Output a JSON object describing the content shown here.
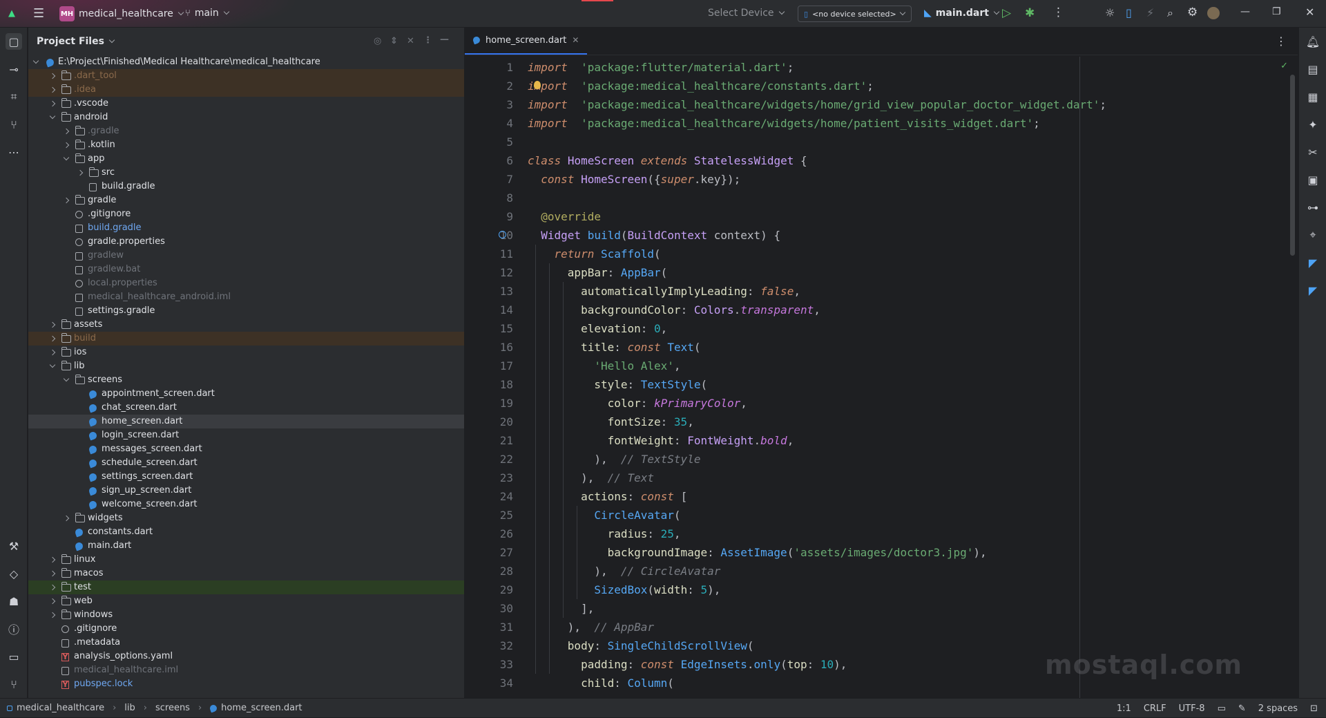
{
  "titlebar": {
    "project_badge": "MH",
    "project_name": "medical_healthcare",
    "branch": "main",
    "select_device": "Select Device",
    "device_selector": "<no device selected>",
    "run_config": "main.dart"
  },
  "panel": {
    "title": "Project Files",
    "root_path": "E:\\Project\\Finished\\Medical Healthcare\\medical_healthcare",
    "tree": [
      {
        "label": ".dart_tool",
        "depth": 1,
        "type": "folder",
        "expanded": false,
        "style": "ignored"
      },
      {
        "label": ".idea",
        "depth": 1,
        "type": "folder",
        "expanded": false,
        "style": "ignored"
      },
      {
        "label": ".vscode",
        "depth": 1,
        "type": "folder",
        "expanded": false,
        "style": ""
      },
      {
        "label": "android",
        "depth": 1,
        "type": "folder",
        "expanded": true,
        "style": ""
      },
      {
        "label": ".gradle",
        "depth": 2,
        "type": "folder",
        "expanded": false,
        "style": "dim"
      },
      {
        "label": ".kotlin",
        "depth": 2,
        "type": "folder",
        "expanded": false,
        "style": ""
      },
      {
        "label": "app",
        "depth": 2,
        "type": "folder",
        "expanded": true,
        "style": ""
      },
      {
        "label": "src",
        "depth": 3,
        "type": "folder",
        "expanded": false,
        "style": ""
      },
      {
        "label": "build.gradle",
        "depth": 3,
        "type": "file",
        "style": ""
      },
      {
        "label": "gradle",
        "depth": 2,
        "type": "folder",
        "expanded": false,
        "style": ""
      },
      {
        "label": ".gitignore",
        "depth": 2,
        "type": "gear",
        "style": ""
      },
      {
        "label": "build.gradle",
        "depth": 2,
        "type": "file",
        "style": "blue"
      },
      {
        "label": "gradle.properties",
        "depth": 2,
        "type": "gear",
        "style": ""
      },
      {
        "label": "gradlew",
        "depth": 2,
        "type": "file",
        "style": "dim"
      },
      {
        "label": "gradlew.bat",
        "depth": 2,
        "type": "file",
        "style": "dim"
      },
      {
        "label": "local.properties",
        "depth": 2,
        "type": "gear",
        "style": "dim"
      },
      {
        "label": "medical_healthcare_android.iml",
        "depth": 2,
        "type": "file",
        "style": "dim"
      },
      {
        "label": "settings.gradle",
        "depth": 2,
        "type": "file",
        "style": ""
      },
      {
        "label": "assets",
        "depth": 1,
        "type": "folder",
        "expanded": false,
        "style": ""
      },
      {
        "label": "build",
        "depth": 1,
        "type": "folder",
        "expanded": false,
        "style": "ignored-dim"
      },
      {
        "label": "ios",
        "depth": 1,
        "type": "folder",
        "expanded": false,
        "style": ""
      },
      {
        "label": "lib",
        "depth": 1,
        "type": "folder",
        "expanded": true,
        "style": ""
      },
      {
        "label": "screens",
        "depth": 2,
        "type": "folder",
        "expanded": true,
        "style": ""
      },
      {
        "label": "appointment_screen.dart",
        "depth": 3,
        "type": "dart",
        "style": ""
      },
      {
        "label": "chat_screen.dart",
        "depth": 3,
        "type": "dart",
        "style": ""
      },
      {
        "label": "home_screen.dart",
        "depth": 3,
        "type": "dart",
        "style": "selected"
      },
      {
        "label": "login_screen.dart",
        "depth": 3,
        "type": "dart",
        "style": ""
      },
      {
        "label": "messages_screen.dart",
        "depth": 3,
        "type": "dart",
        "style": ""
      },
      {
        "label": "schedule_screen.dart",
        "depth": 3,
        "type": "dart",
        "style": ""
      },
      {
        "label": "settings_screen.dart",
        "depth": 3,
        "type": "dart",
        "style": ""
      },
      {
        "label": "sign_up_screen.dart",
        "depth": 3,
        "type": "dart",
        "style": ""
      },
      {
        "label": "welcome_screen.dart",
        "depth": 3,
        "type": "dart",
        "style": ""
      },
      {
        "label": "widgets",
        "depth": 2,
        "type": "folder",
        "expanded": false,
        "style": ""
      },
      {
        "label": "constants.dart",
        "depth": 2,
        "type": "dart",
        "style": ""
      },
      {
        "label": "main.dart",
        "depth": 2,
        "type": "dart",
        "style": ""
      },
      {
        "label": "linux",
        "depth": 1,
        "type": "folder",
        "expanded": false,
        "style": ""
      },
      {
        "label": "macos",
        "depth": 1,
        "type": "folder",
        "expanded": false,
        "style": ""
      },
      {
        "label": "test",
        "depth": 1,
        "type": "folder",
        "expanded": false,
        "style": "test"
      },
      {
        "label": "web",
        "depth": 1,
        "type": "folder",
        "expanded": false,
        "style": ""
      },
      {
        "label": "windows",
        "depth": 1,
        "type": "folder",
        "expanded": false,
        "style": ""
      },
      {
        "label": ".gitignore",
        "depth": 1,
        "type": "gear",
        "style": ""
      },
      {
        "label": ".metadata",
        "depth": 1,
        "type": "lines",
        "style": ""
      },
      {
        "label": "analysis_options.yaml",
        "depth": 1,
        "type": "yaml",
        "style": ""
      },
      {
        "label": "medical_healthcare.iml",
        "depth": 1,
        "type": "file",
        "style": "dim"
      },
      {
        "label": "pubspec.lock",
        "depth": 1,
        "type": "yaml",
        "style": "blue"
      }
    ]
  },
  "editor": {
    "tab_label": "home_screen.dart",
    "lines": [
      [
        [
          "kw",
          "import"
        ],
        [
          "",
          "  "
        ],
        [
          "s",
          "'package:flutter/material.dart'"
        ],
        [
          "",
          ";"
        ]
      ],
      [
        [
          "kw",
          "import"
        ],
        [
          "",
          "  "
        ],
        [
          "s",
          "'package:medical_healthcare/constants.dart'"
        ],
        [
          "",
          ";"
        ]
      ],
      [
        [
          "kw",
          "import"
        ],
        [
          "",
          "  "
        ],
        [
          "s",
          "'package:medical_healthcare/widgets/home/grid_view_popular_doctor_widget.dart'"
        ],
        [
          "",
          ";"
        ]
      ],
      [
        [
          "kw",
          "import"
        ],
        [
          "",
          "  "
        ],
        [
          "s",
          "'package:medical_healthcare/widgets/home/patient_visits_widget.dart'"
        ],
        [
          "",
          ";"
        ]
      ],
      [],
      [
        [
          "kw",
          "class"
        ],
        [
          "",
          " "
        ],
        [
          "cls",
          "HomeScreen"
        ],
        [
          "",
          " "
        ],
        [
          "kw",
          "extends"
        ],
        [
          "",
          " "
        ],
        [
          "cls",
          "StatelessWidget"
        ],
        [
          "",
          " {"
        ]
      ],
      [
        [
          "",
          "  "
        ],
        [
          "kw",
          "const"
        ],
        [
          "",
          " "
        ],
        [
          "cls",
          "HomeScreen"
        ],
        [
          "",
          "({"
        ],
        [
          "kw",
          "super"
        ],
        [
          "",
          ".key});"
        ]
      ],
      [],
      [
        [
          "",
          "  "
        ],
        [
          "an",
          "@override"
        ]
      ],
      [
        [
          "",
          "  "
        ],
        [
          "cls",
          "Widget"
        ],
        [
          "",
          " "
        ],
        [
          "fn",
          "build"
        ],
        [
          "",
          "("
        ],
        [
          "cls",
          "BuildContext"
        ],
        [
          "",
          " context) {"
        ]
      ],
      [
        [
          "",
          "    "
        ],
        [
          "kw",
          "return"
        ],
        [
          "",
          " "
        ],
        [
          "fn",
          "Scaffold"
        ],
        [
          "",
          "("
        ]
      ],
      [
        [
          "",
          "      "
        ],
        [
          "prm",
          "appBar"
        ],
        [
          "",
          ": "
        ],
        [
          "fn",
          "AppBar"
        ],
        [
          "",
          "("
        ]
      ],
      [
        [
          "",
          "        "
        ],
        [
          "prm",
          "automaticallyImplyLeading"
        ],
        [
          "",
          ": "
        ],
        [
          "kw",
          "false"
        ],
        [
          "",
          ","
        ]
      ],
      [
        [
          "",
          "        "
        ],
        [
          "prm",
          "backgroundColor"
        ],
        [
          "",
          ": "
        ],
        [
          "cls",
          "Colors"
        ],
        [
          "",
          "."
        ],
        [
          "ki",
          "transparent"
        ],
        [
          "",
          ","
        ]
      ],
      [
        [
          "",
          "        "
        ],
        [
          "prm",
          "elevation"
        ],
        [
          "",
          ": "
        ],
        [
          "num",
          "0"
        ],
        [
          "",
          ","
        ]
      ],
      [
        [
          "",
          "        "
        ],
        [
          "prm",
          "title"
        ],
        [
          "",
          ": "
        ],
        [
          "kw",
          "const"
        ],
        [
          "",
          " "
        ],
        [
          "fn",
          "Text"
        ],
        [
          "",
          "("
        ]
      ],
      [
        [
          "",
          "          "
        ],
        [
          "s",
          "'Hello Alex'"
        ],
        [
          "",
          ","
        ]
      ],
      [
        [
          "",
          "          "
        ],
        [
          "prm",
          "style"
        ],
        [
          "",
          ": "
        ],
        [
          "fn",
          "TextStyle"
        ],
        [
          "",
          "("
        ]
      ],
      [
        [
          "",
          "            "
        ],
        [
          "prm",
          "color"
        ],
        [
          "",
          ": "
        ],
        [
          "ki",
          "kPrimaryColor"
        ],
        [
          "",
          ","
        ]
      ],
      [
        [
          "",
          "            "
        ],
        [
          "prm",
          "fontSize"
        ],
        [
          "",
          ": "
        ],
        [
          "num",
          "35"
        ],
        [
          "",
          ","
        ]
      ],
      [
        [
          "",
          "            "
        ],
        [
          "prm",
          "fontWeight"
        ],
        [
          "",
          ": "
        ],
        [
          "cls",
          "FontWeight"
        ],
        [
          "",
          "."
        ],
        [
          "ki",
          "bold"
        ],
        [
          "",
          ","
        ]
      ],
      [
        [
          "",
          "          "
        ],
        [
          "",
          "),  "
        ],
        [
          "c",
          "// TextStyle"
        ]
      ],
      [
        [
          "",
          "        "
        ],
        [
          "",
          "),  "
        ],
        [
          "c",
          "// Text"
        ]
      ],
      [
        [
          "",
          "        "
        ],
        [
          "prm",
          "actions"
        ],
        [
          "",
          ": "
        ],
        [
          "kw",
          "const"
        ],
        [
          "",
          " ["
        ]
      ],
      [
        [
          "",
          "          "
        ],
        [
          "fn",
          "CircleAvatar"
        ],
        [
          "",
          "("
        ]
      ],
      [
        [
          "",
          "            "
        ],
        [
          "prm",
          "radius"
        ],
        [
          "",
          ": "
        ],
        [
          "num",
          "25"
        ],
        [
          "",
          ","
        ]
      ],
      [
        [
          "",
          "            "
        ],
        [
          "prm",
          "backgroundImage"
        ],
        [
          "",
          ": "
        ],
        [
          "fn",
          "AssetImage"
        ],
        [
          "",
          "("
        ],
        [
          "s",
          "'assets/images/doctor3.jpg'"
        ],
        [
          "",
          "),"
        ]
      ],
      [
        [
          "",
          "          "
        ],
        [
          "",
          "),  "
        ],
        [
          "c",
          "// CircleAvatar"
        ]
      ],
      [
        [
          "",
          "          "
        ],
        [
          "fn",
          "SizedBox"
        ],
        [
          "",
          "("
        ],
        [
          "prm",
          "width"
        ],
        [
          "",
          ": "
        ],
        [
          "num",
          "5"
        ],
        [
          "",
          "),"
        ]
      ],
      [
        [
          "",
          "        "
        ],
        [
          "",
          "],"
        ]
      ],
      [
        [
          "",
          "      "
        ],
        [
          "",
          "),  "
        ],
        [
          "c",
          "// AppBar"
        ]
      ],
      [
        [
          "",
          "      "
        ],
        [
          "prm",
          "body"
        ],
        [
          "",
          ": "
        ],
        [
          "fn",
          "SingleChildScrollView"
        ],
        [
          "",
          "("
        ]
      ],
      [
        [
          "",
          "        "
        ],
        [
          "prm",
          "padding"
        ],
        [
          "",
          ": "
        ],
        [
          "kw",
          "const"
        ],
        [
          "",
          " "
        ],
        [
          "fn",
          "EdgeInsets"
        ],
        [
          "",
          "."
        ],
        [
          "fn",
          "only"
        ],
        [
          "",
          "("
        ],
        [
          "prm",
          "top"
        ],
        [
          "",
          ": "
        ],
        [
          "num",
          "10"
        ],
        [
          "",
          "),"
        ]
      ],
      [
        [
          "",
          "        "
        ],
        [
          "prm",
          "child"
        ],
        [
          "",
          ": "
        ],
        [
          "fn",
          "Column"
        ],
        [
          "",
          "("
        ]
      ]
    ]
  },
  "statusbar": {
    "breadcrumb": [
      "medical_healthcare",
      "lib",
      "screens",
      "home_screen.dart"
    ],
    "position": "1:1",
    "line_ending": "CRLF",
    "encoding": "UTF-8",
    "indent": "2 spaces"
  },
  "watermark": "mostaql.com"
}
